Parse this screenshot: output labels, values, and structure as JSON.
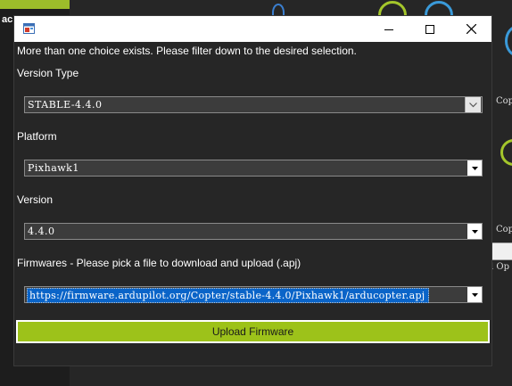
{
  "background": {
    "left_text": "ac",
    "copter_label_1": "Copt",
    "copter_label_2": "Copt",
    "op_label": "l Op"
  },
  "dialog": {
    "hint": "More than one choice exists. Please filter down to the desired selection.",
    "version_type": {
      "label": "Version Type",
      "value": "STABLE-4.4.0"
    },
    "platform": {
      "label": "Platform",
      "value": "Pixhawk1"
    },
    "version": {
      "label": "Version",
      "value": "4.4.0"
    },
    "firmwares": {
      "label": "Firmwares - Please pick a file to download and upload (.apj)",
      "value": "https://firmware.ardupilot.org/Copter/stable-4.4.0/Pixhawk1/arducopter.apj"
    },
    "upload_label": "Upload Firmware"
  },
  "colors": {
    "accent_green": "#9dc21a",
    "background": "#262626",
    "selection_blue": "#0a64c8"
  },
  "icons": [
    "app-icon",
    "minimize-icon",
    "maximize-icon",
    "close-icon",
    "chevron-down-icon"
  ]
}
